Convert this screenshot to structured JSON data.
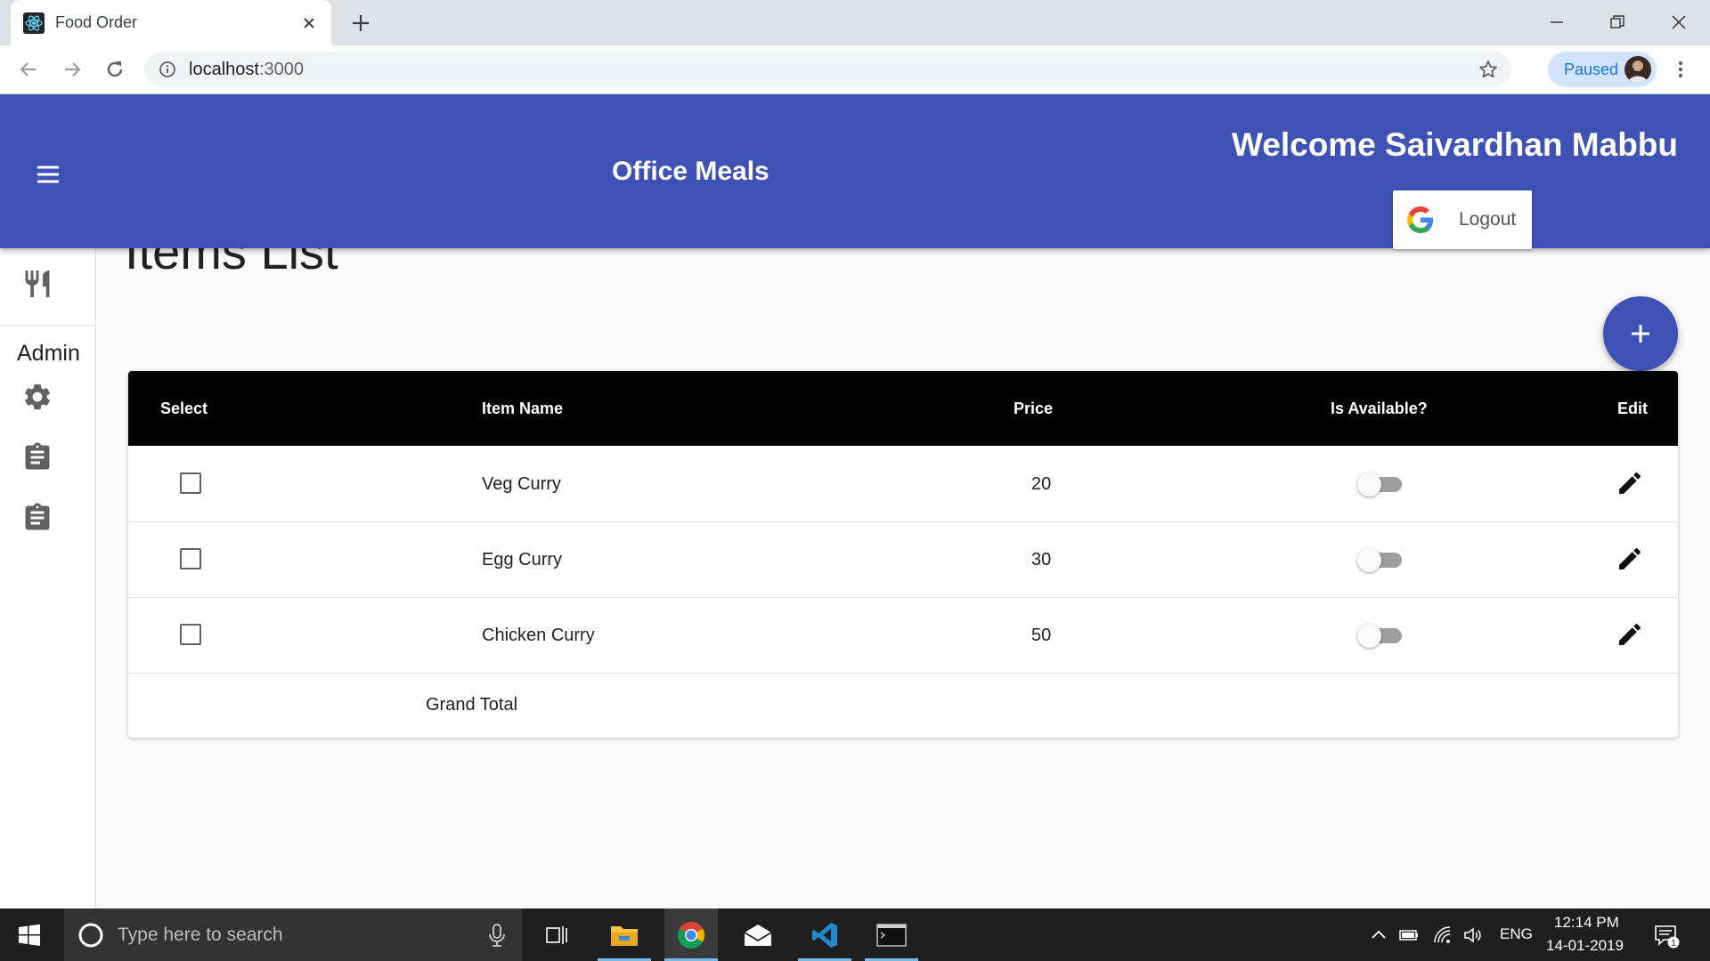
{
  "browser": {
    "tab_title": "Food Order",
    "url_host": "localhost",
    "url_port": ":3000",
    "profile_label": "Paused"
  },
  "header": {
    "app_title": "Office Meals",
    "welcome_text": "Welcome Saivardhan Mabbu",
    "logout_label": "Logout"
  },
  "drawer": {
    "section_label": "Admin",
    "items": [
      {
        "icon": "restaurant-icon"
      },
      {
        "icon": "settings-icon"
      },
      {
        "icon": "assignment-icon"
      },
      {
        "icon": "assignment-icon"
      }
    ]
  },
  "main": {
    "heading": "Items List",
    "add_button_icon": "plus-icon",
    "table": {
      "columns": [
        "Select",
        "Item Name",
        "Price",
        "Is Available?",
        "Edit"
      ],
      "rows": [
        {
          "name": "Veg Curry",
          "price": "20",
          "available": false,
          "selected": false
        },
        {
          "name": "Egg Curry",
          "price": "30",
          "available": false,
          "selected": false
        },
        {
          "name": "Chicken Curry",
          "price": "50",
          "available": false,
          "selected": false
        }
      ],
      "grand_total_label": "Grand Total"
    }
  },
  "taskbar": {
    "search_placeholder": "Type here to search",
    "language": "ENG",
    "time": "12:14 PM",
    "date": "14-01-2019",
    "notification_count": "1"
  },
  "colors": {
    "primary": "#3f51b5",
    "table_header": "#000000",
    "taskbar": "#1f1f1f"
  }
}
